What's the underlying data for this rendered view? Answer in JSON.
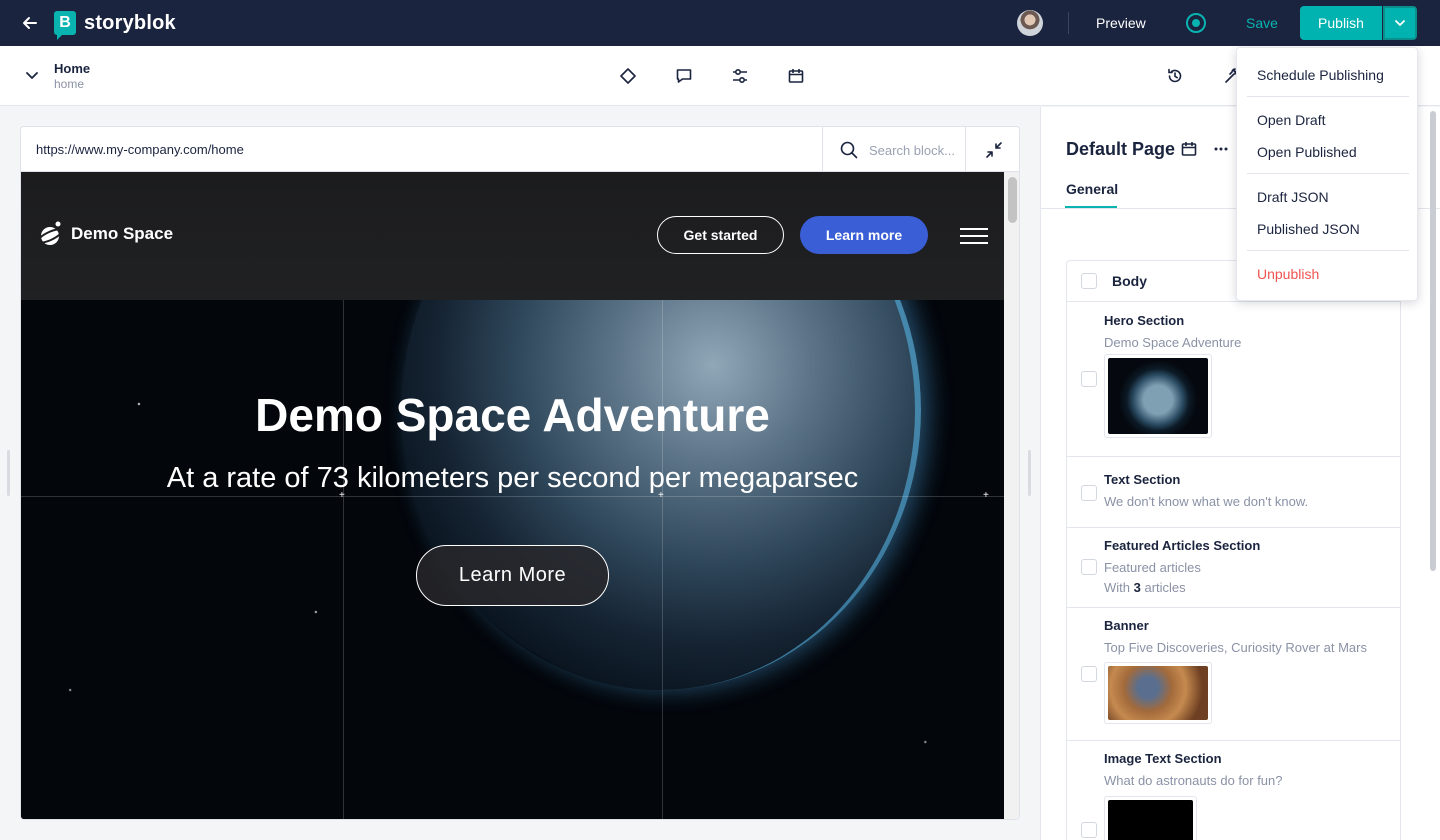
{
  "app": {
    "logo_text": "storyblok",
    "logo_letter": "B",
    "brand_color": "#09b3af"
  },
  "topbar": {
    "preview_label": "Preview",
    "save_label": "Save",
    "publish_label": "Publish"
  },
  "story": {
    "title": "Home",
    "slug": "home"
  },
  "preview": {
    "url": "https://www.my-company.com/home",
    "search_placeholder": "Search block..."
  },
  "site": {
    "logo_text": "Demo Space",
    "get_started_label": "Get started",
    "learn_more_label": "Learn more",
    "hero_title": "Demo Space Adventure",
    "hero_subtitle": "At a rate of 73 kilometers per second per megaparsec",
    "hero_button_label": "Learn More",
    "accent_color": "#3a5ed6"
  },
  "panel": {
    "title": "Default Page",
    "tab_general": "General",
    "body_label": "Body",
    "bloks": [
      {
        "name": "Hero Section",
        "desc": "Demo Space Adventure"
      },
      {
        "name": "Text Section",
        "desc": "We don't know what we don't know."
      },
      {
        "name": "Featured Articles Section",
        "desc": "Featured articles",
        "extra_prefix": "With ",
        "extra_count": "3",
        "extra_suffix": " articles"
      },
      {
        "name": "Banner",
        "desc": "Top Five Discoveries, Curiosity Rover at Mars"
      },
      {
        "name": "Image Text Section",
        "desc": "What do astronauts do for fun?"
      }
    ]
  },
  "dropdown": {
    "items": [
      "Schedule Publishing",
      "Open Draft",
      "Open Published",
      "Draft JSON",
      "Published JSON",
      "Unpublish"
    ],
    "danger_color": "#f0544f"
  }
}
